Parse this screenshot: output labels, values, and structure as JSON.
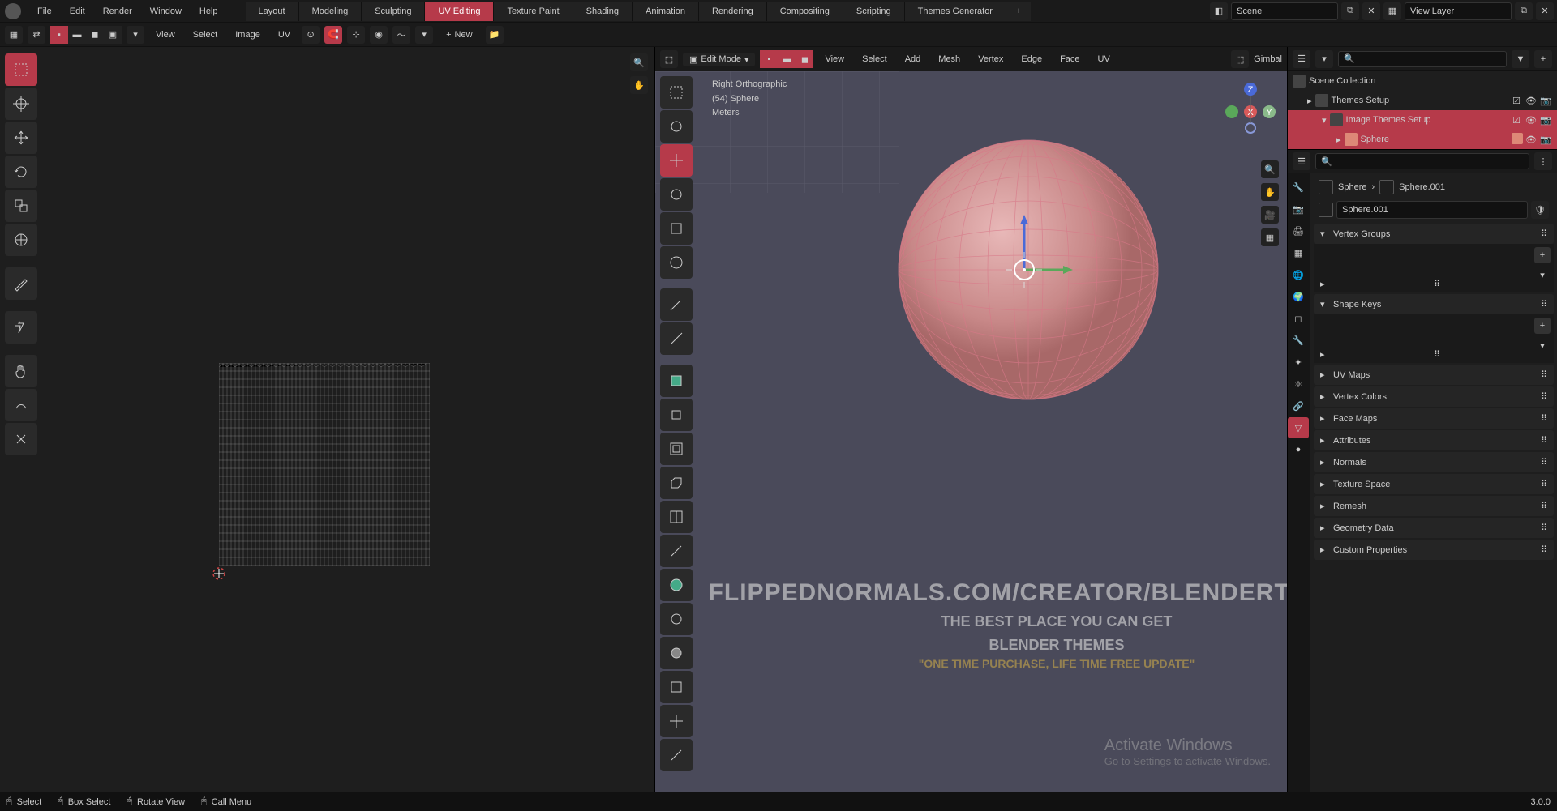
{
  "menus": {
    "file": "File",
    "edit": "Edit",
    "render": "Render",
    "window": "Window",
    "help": "Help"
  },
  "workspaces": [
    "Layout",
    "Modeling",
    "Sculpting",
    "UV Editing",
    "Texture Paint",
    "Shading",
    "Animation",
    "Rendering",
    "Compositing",
    "Scripting",
    "Themes Generator"
  ],
  "active_workspace": "UV Editing",
  "scene_name": "Scene",
  "layer_name": "View Layer",
  "uv_header": {
    "view": "View",
    "select": "Select",
    "image": "Image",
    "uv": "UV",
    "new": "New",
    "open": "Open"
  },
  "v3d_header": {
    "mode": "Edit Mode",
    "view": "View",
    "select": "Select",
    "add": "Add",
    "mesh": "Mesh",
    "vertex": "Vertex",
    "edge": "Edge",
    "face": "Face",
    "uv": "UV",
    "gimbal": "Gimbal"
  },
  "overlay": {
    "view": "Right Orthographic",
    "obj": "(54) Sphere",
    "units": "Meters"
  },
  "outliner": {
    "scene_collection": "Scene Collection",
    "themes_setup": "Themes Setup",
    "image_themes": "Image Themes Setup",
    "sphere": "Sphere"
  },
  "breadcrumb": {
    "obj": "Sphere",
    "data": "Sphere.001"
  },
  "mesh_name": "Sphere.001",
  "panels": {
    "vertex_groups": "Vertex Groups",
    "shape_keys": "Shape Keys",
    "uv_maps": "UV Maps",
    "vertex_colors": "Vertex Colors",
    "face_maps": "Face Maps",
    "attributes": "Attributes",
    "normals": "Normals",
    "texture_space": "Texture Space",
    "remesh": "Remesh",
    "geometry_data": "Geometry Data",
    "custom_props": "Custom Properties"
  },
  "watermark": {
    "url": "FLIPPEDNORMALS.COM/CREATOR/BLENDERTHEMES",
    "line1": "THE BEST PLACE YOU CAN GET",
    "line2": "BLENDER THEMES",
    "line3": "\"ONE TIME PURCHASE, LIFE TIME FREE UPDATE\""
  },
  "activate": {
    "title": "Activate Windows",
    "sub": "Go to Settings to activate Windows."
  },
  "status": {
    "select": "Select",
    "box": "Box Select",
    "rotate": "Rotate View",
    "menu": "Call Menu"
  },
  "version": "3.0.0"
}
